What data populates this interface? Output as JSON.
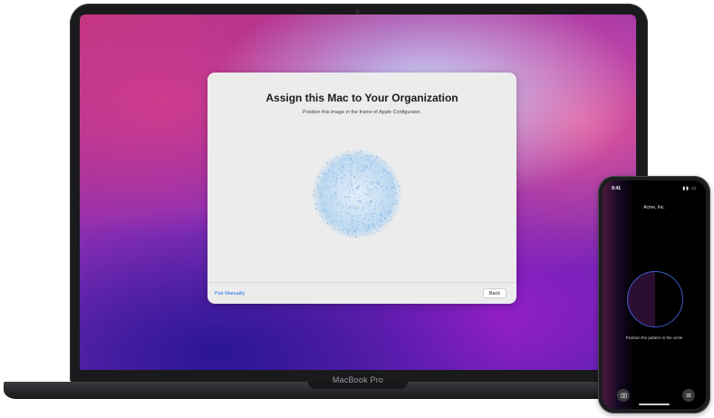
{
  "dialog": {
    "title": "Assign this Mac to Your Organization",
    "subtitle": "Position this image in the frame of Apple Configurator.",
    "pair_manually_label": "Pair Manually",
    "back_label": "Back"
  },
  "laptop": {
    "brand_label": "MacBook Pro"
  },
  "phone": {
    "time": "9:41",
    "organization": "Acme, Inc.",
    "hint": "Position the pattern in the circle",
    "left_button_icon": "camera-icon",
    "right_button_icon": "menu-icon"
  },
  "colors": {
    "link": "#1f6fe0",
    "pattern": "#9ec8ee",
    "dialog_bg": "#ececec"
  }
}
